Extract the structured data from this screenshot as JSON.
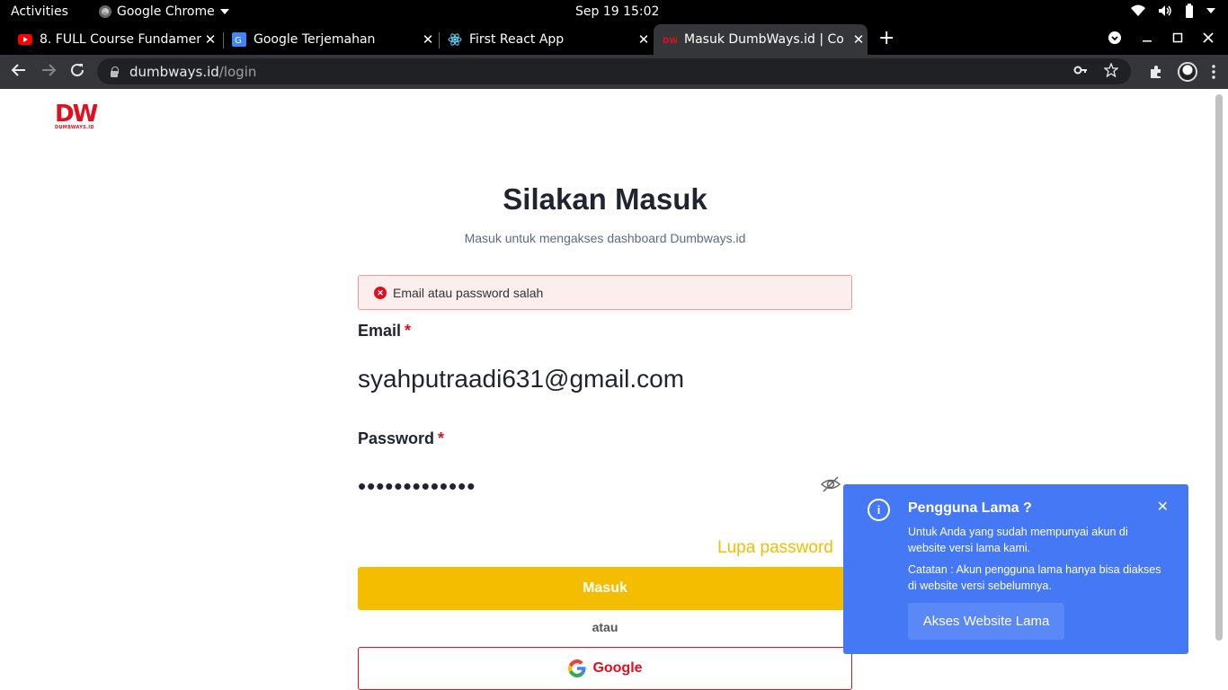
{
  "system_bar": {
    "activities": "Activities",
    "app_name": "Google Chrome",
    "clock": "Sep 19  15:02"
  },
  "tabs": [
    {
      "title": "8. FULL Course Fundamen",
      "favicon": "youtube-icon",
      "active": false
    },
    {
      "title": "Google Terjemahan",
      "favicon": "google-translate-icon",
      "active": false
    },
    {
      "title": "First React App",
      "favicon": "react-icon",
      "active": false
    },
    {
      "title": "Masuk DumbWays.id | Co",
      "favicon": "dumbways-icon",
      "active": true
    }
  ],
  "omnibox": {
    "host": "dumbways.id",
    "path": "/login"
  },
  "page": {
    "logo_mark": "DW",
    "logo_text": "DUMBWAYS.ID",
    "heading": "Silakan Masuk",
    "subheading": "Masuk untuk mengakses dashboard Dumbways.id",
    "alert": "Email atau password salah",
    "email_label": "Email",
    "email_value": "syahputraadi631@gmail.com",
    "password_label": "Password",
    "password_value": "•••••••••••••",
    "required_mark": "*",
    "forgot": "Lupa password",
    "login_button": "Masuk",
    "or_text": "atau",
    "google_button": "Google"
  },
  "notice": {
    "title": "Pengguna Lama ?",
    "text1": "Untuk Anda yang sudah mempunyai akun di website versi lama kami.",
    "text2": "Catatan : Akun pengguna lama hanya bisa diakses di website versi sebelumnya.",
    "button": "Akses Website Lama"
  },
  "colors": {
    "brand_red": "#e0101e",
    "accent_yellow": "#f5bd00",
    "notice_blue": "#4578f5"
  }
}
